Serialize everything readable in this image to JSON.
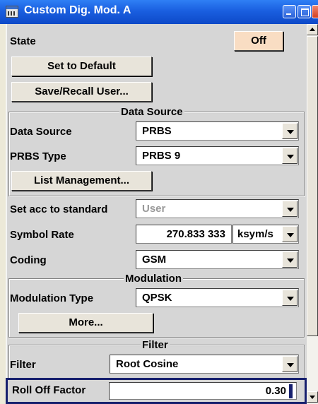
{
  "window": {
    "title": "Custom Dig. Mod. A"
  },
  "state": {
    "label": "State",
    "button": "Off"
  },
  "buttons": {
    "set_default": "Set to Default",
    "save_recall": "Save/Recall User..."
  },
  "data_source_group": {
    "title": "Data Source",
    "data_source": {
      "label": "Data Source",
      "value": "PRBS"
    },
    "prbs_type": {
      "label": "PRBS Type",
      "value": "PRBS 9"
    },
    "list_management": "List Management..."
  },
  "set_acc": {
    "label": "Set acc to standard",
    "value": "User"
  },
  "symbol_rate": {
    "label": "Symbol Rate",
    "value": "270.833 333",
    "unit": "ksym/s"
  },
  "coding": {
    "label": "Coding",
    "value": "GSM"
  },
  "modulation_group": {
    "title": "Modulation",
    "modulation_type": {
      "label": "Modulation Type",
      "value": "QPSK"
    },
    "more": "More..."
  },
  "filter_group": {
    "title": "Filter",
    "filter": {
      "label": "Filter",
      "value": "Root Cosine"
    },
    "roll_off": {
      "label": "Roll Off Factor",
      "value": "0.30"
    }
  }
}
